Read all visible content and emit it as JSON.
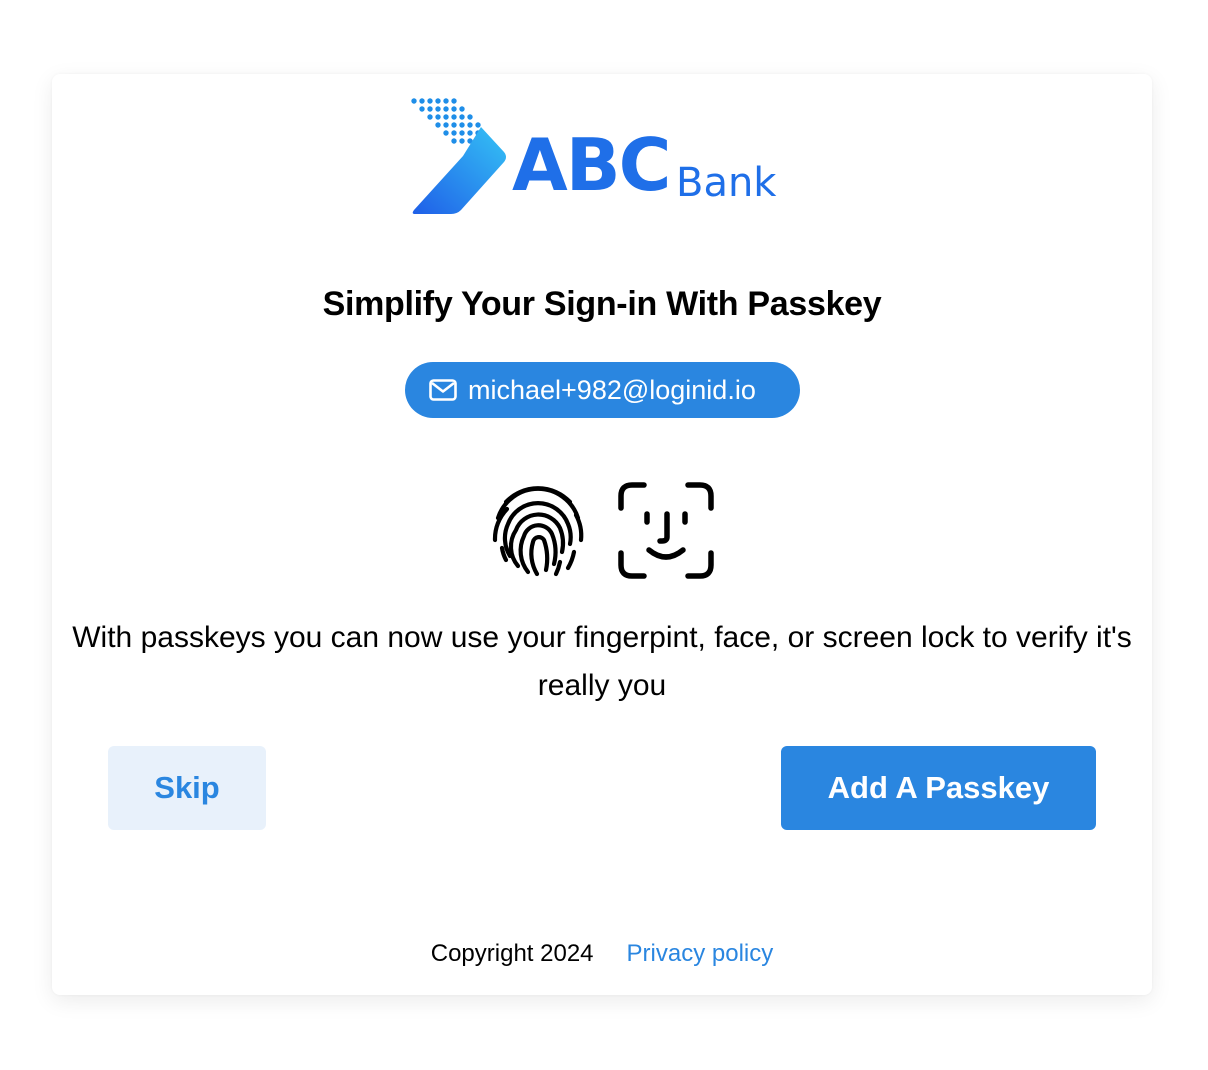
{
  "brand": {
    "logo_main": "ABC",
    "logo_sub": "Bank",
    "color": "#1f6fe8"
  },
  "heading": "Simplify Your Sign-in With Passkey",
  "account": {
    "email": "michael+982@loginid.io",
    "icon": "mail-icon"
  },
  "biometrics": {
    "icons": [
      "fingerprint-icon",
      "face-id-icon"
    ]
  },
  "description": "With passkeys you can now use your fingerpint, face, or screen lock to verify it's really you",
  "actions": {
    "skip_label": "Skip",
    "add_label": "Add A Passkey"
  },
  "footer": {
    "copyright": "Copyright 2024",
    "privacy_label": "Privacy policy"
  },
  "colors": {
    "accent": "#2a86e0",
    "skip_bg": "#e8f1fb"
  }
}
